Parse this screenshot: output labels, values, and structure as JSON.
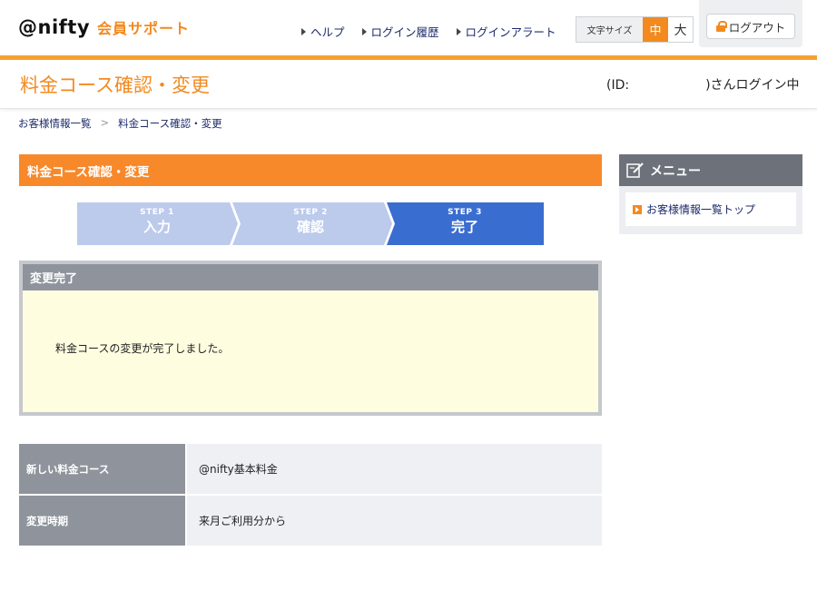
{
  "header": {
    "logo": "@nifty",
    "logo_sub": "会員サポート",
    "nav": [
      "ヘルプ",
      "ログイン履歴",
      "ログインアラート"
    ],
    "font_size_label": "文字サイズ",
    "font_size_mid": "中",
    "font_size_large": "大",
    "logout": "ログアウト"
  },
  "title": {
    "page_title": "料金コース確認・変更",
    "login_status": "(ID:　　　　　　)さんログイン中"
  },
  "breadcrumb": {
    "home": "お客様情報一覧",
    "sep": ">",
    "current": "料金コース確認・変更"
  },
  "main": {
    "section_title": "料金コース確認・変更",
    "steps": [
      {
        "label": "STEP 1",
        "name": "入力"
      },
      {
        "label": "STEP 2",
        "name": "確認"
      },
      {
        "label": "STEP 3",
        "name": "完了"
      }
    ],
    "done_title": "変更完了",
    "done_message": "料金コースの変更が完了しました。",
    "rows": [
      {
        "label": "新しい料金コース",
        "value": "@nifty基本料金"
      },
      {
        "label": "変更時期",
        "value": "来月ご利用分から"
      }
    ]
  },
  "sidebar": {
    "title": "メニュー",
    "item": "お客様情報一覧トップ"
  },
  "colors": {
    "accent": "#f28a20",
    "step_inactive": "#bccaeb",
    "step_active": "#3a6dd0"
  }
}
